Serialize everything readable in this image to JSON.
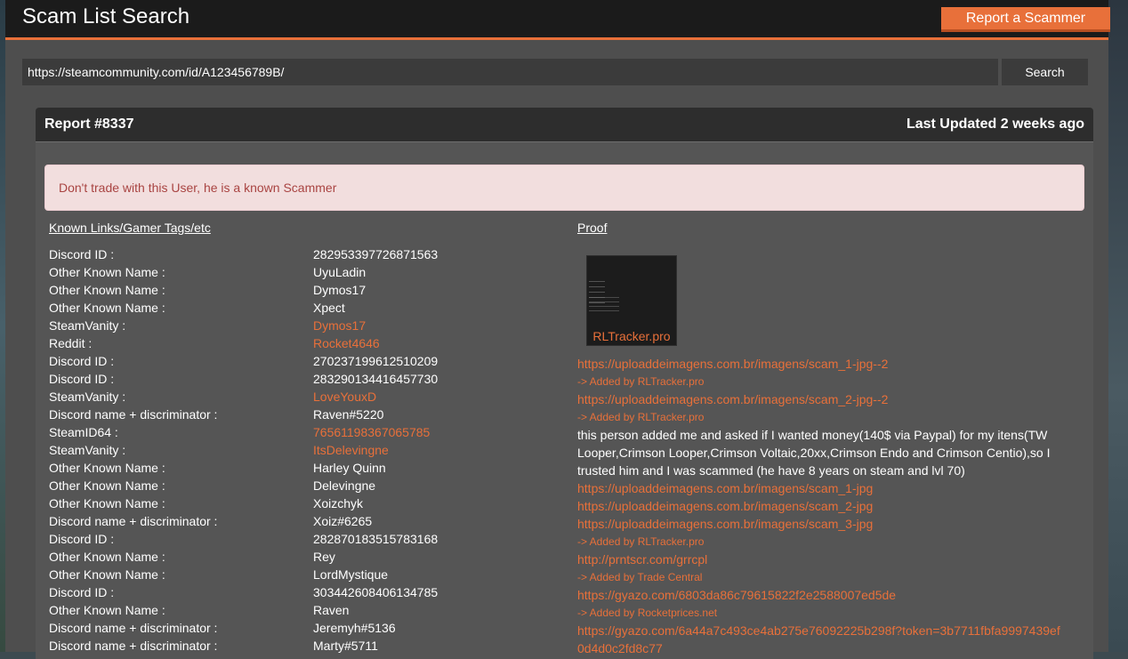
{
  "header": {
    "title": "Scam List Search",
    "report_button": "Report a Scammer"
  },
  "search": {
    "value": "https://steamcommunity.com/id/A123456789B/",
    "button": "Search"
  },
  "report": {
    "number": "Report #8337",
    "updated": "Last Updated 2 weeks ago",
    "alert": "Don't trade with this User, he is a known Scammer",
    "links_title": "Known Links/Gamer Tags/etc",
    "proof_title": "Proof",
    "entries": [
      {
        "key": "Discord ID :",
        "value": "282953397726871563",
        "link": false
      },
      {
        "key": "Other Known Name :",
        "value": "UyuLadin",
        "link": false
      },
      {
        "key": "Other Known Name :",
        "value": "Dymos17",
        "link": false
      },
      {
        "key": "Other Known Name :",
        "value": "Xpect",
        "link": false
      },
      {
        "key": "SteamVanity :",
        "value": "Dymos17",
        "link": true
      },
      {
        "key": "Reddit :",
        "value": "Rocket4646",
        "link": true
      },
      {
        "key": "Discord ID :",
        "value": "270237199612510209",
        "link": false
      },
      {
        "key": "Discord ID :",
        "value": "283290134416457730",
        "link": false
      },
      {
        "key": "SteamVanity :",
        "value": "LoveYouxD",
        "link": true
      },
      {
        "key": "Discord name + discriminator :",
        "value": "Raven#5220",
        "link": false
      },
      {
        "key": "SteamID64 :",
        "value": "76561198367065785",
        "link": true
      },
      {
        "key": "SteamVanity :",
        "value": "ItsDelevingne",
        "link": true
      },
      {
        "key": "Other Known Name :",
        "value": "Harley Quinn",
        "link": false
      },
      {
        "key": "Other Known Name :",
        "value": "Delevingne",
        "link": false
      },
      {
        "key": "Other Known Name :",
        "value": "Xoizchyk",
        "link": false
      },
      {
        "key": "Discord name + discriminator :",
        "value": "Xoiz#6265",
        "link": false
      },
      {
        "key": "Discord ID :",
        "value": "282870183515783168",
        "link": false
      },
      {
        "key": "Other Known Name :",
        "value": "Rey",
        "link": false
      },
      {
        "key": "Other Known Name :",
        "value": "LordMystique",
        "link": false
      },
      {
        "key": "Discord ID :",
        "value": "303442608406134785",
        "link": false
      },
      {
        "key": "Other Known Name :",
        "value": "Raven",
        "link": false
      },
      {
        "key": "Discord name + discriminator :",
        "value": "Jeremyh#5136",
        "link": false
      },
      {
        "key": "Discord name + discriminator :",
        "value": "Marty#5711",
        "link": false
      }
    ],
    "proof": {
      "thumb_caption": "RLTracker.pro",
      "link1": "https://uploaddeimagens.com.br/imagens/scam_1-jpg--2",
      "added1": "-> Added by RLTracker.pro",
      "link2": "https://uploaddeimagens.com.br/imagens/scam_2-jpg--2",
      "added2": "-> Added by RLTracker.pro",
      "text": "this person added me and asked if I wanted money(140$ via Paypal) for my itens(TW Looper,Crimson Looper,Crimson Voltaic,20xx,Crimson Endo and Crimson Centio),so I trusted him and I was scammed (he have 8 years on steam and lvl 70)",
      "link3": "https://uploaddeimagens.com.br/imagens/scam_1-jpg",
      "link4": "https://uploaddeimagens.com.br/imagens/scam_2-jpg",
      "link5": "https://uploaddeimagens.com.br/imagens/scam_3-jpg",
      "added3": "-> Added by RLTracker.pro",
      "link6": "http://prntscr.com/grrcpl",
      "added4": "-> Added by Trade Central",
      "link7": "https://gyazo.com/6803da86c79615822f2e2588007ed5de",
      "added5": "-> Added by Rocketprices.net",
      "link8": "https://gyazo.com/6a44a7c493ce4ab275e76092225b298f?token=3b7711fbfa9997439ef0d4d0c2fd8c77"
    }
  }
}
